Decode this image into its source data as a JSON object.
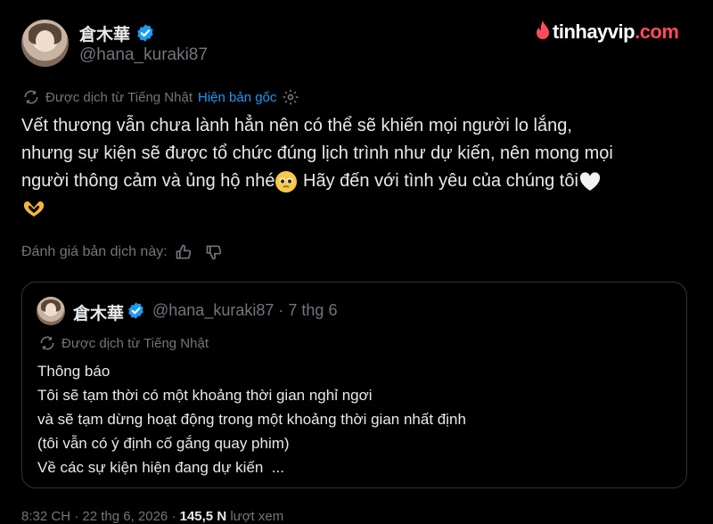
{
  "author": {
    "name": "倉木華",
    "handle": "@hana_kuraki87"
  },
  "watermark": {
    "brand": "tinhayvip",
    "tld": ".com"
  },
  "translation": {
    "label": "Được dịch từ Tiếng Nhật",
    "show_original": "Hiện bản gốc"
  },
  "tweet": {
    "line1": "Vết thương vẫn chưa lành hẳn nên có thể sẽ khiến mọi người lo lắng,",
    "line2": "nhưng sự kiện sẽ được tổ chức đúng lịch trình như dự kiến, nên mong mọi",
    "line3a": "người thông cảm và ủng hộ nhé",
    "line3b": " Hãy đến với tình yêu của chúng tôi"
  },
  "rate": {
    "label": "Đánh giá bản dịch này:"
  },
  "quote": {
    "name": "倉木華",
    "handle": "@hana_kuraki87",
    "separator": "·",
    "date": "7 thg 6",
    "translation_label": "Được dịch từ Tiếng Nhật",
    "lines": [
      "Thông báo",
      "Tôi sẽ tạm thời có một khoảng thời gian nghỉ ngơi",
      "và sẽ tạm dừng hoạt động trong một khoảng thời gian nhất định",
      "(tôi vẫn có ý định cố gắng quay phim)",
      "Về các sự kiện hiện đang dự kiến  ..."
    ]
  },
  "footer": {
    "time": "8:32 CH · 22 thg 6, 2026 ·",
    "views_count": "145,5 N",
    "views_label": "lượt xem"
  },
  "colors": {
    "background": "#000000",
    "text": "#e7e9ea",
    "muted": "#71767b",
    "link": "#1d9bf0",
    "border": "#2f3336",
    "brand": "#ff4b5c"
  }
}
